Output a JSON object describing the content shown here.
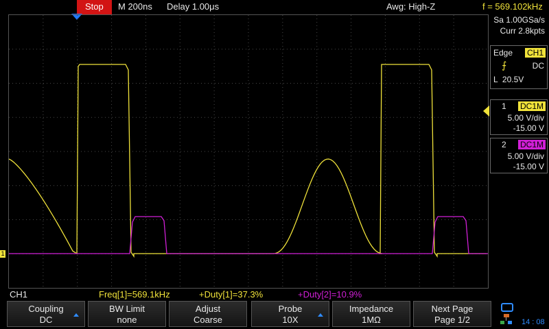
{
  "topbar": {
    "run_state": "Stop",
    "timebase": "M 200ns",
    "delay": "Delay 1.00μs",
    "awg": "Awg: High-Z",
    "freq": "f = 569.102kHz"
  },
  "acquisition": {
    "sample_rate": "Sa 1.00GSa/s",
    "memory": "Curr 2.8kpts"
  },
  "trigger": {
    "type": "Edge",
    "source": "CH1",
    "coupling": "DC",
    "level": "L  20.5V"
  },
  "channels": [
    {
      "num": "1",
      "coupling": "DC1M",
      "scale": "5.00 V/div",
      "offset": "-15.00 V",
      "color": "#f0e23a"
    },
    {
      "num": "2",
      "coupling": "DC1M",
      "scale": "5.00 V/div",
      "offset": "-15.00 V",
      "color": "#d01fd6"
    }
  ],
  "status": {
    "active_channel": "CH1",
    "meas1": "Freq[1]=569.1kHz",
    "meas2": "+Duty[1]=37.3%",
    "meas3": "+Duty[2]=10.9%"
  },
  "softkeys": [
    {
      "label": "Coupling",
      "value": "DC",
      "arrow": true
    },
    {
      "label": "BW Limit",
      "value": "none",
      "arrow": false
    },
    {
      "label": "Adjust",
      "value": "Coarse",
      "arrow": false
    },
    {
      "label": "Probe",
      "value": "10X",
      "arrow": true
    },
    {
      "label": "Impedance",
      "value": "1MΩ",
      "arrow": false
    },
    {
      "label": "Next Page",
      "value": "Page 1/2",
      "arrow": false
    }
  ],
  "clock": "14 : 08",
  "colors": {
    "ch1": "#f0e23a",
    "ch2": "#d01fd6",
    "stop": "#d21414",
    "accent": "#1e78ff"
  }
}
